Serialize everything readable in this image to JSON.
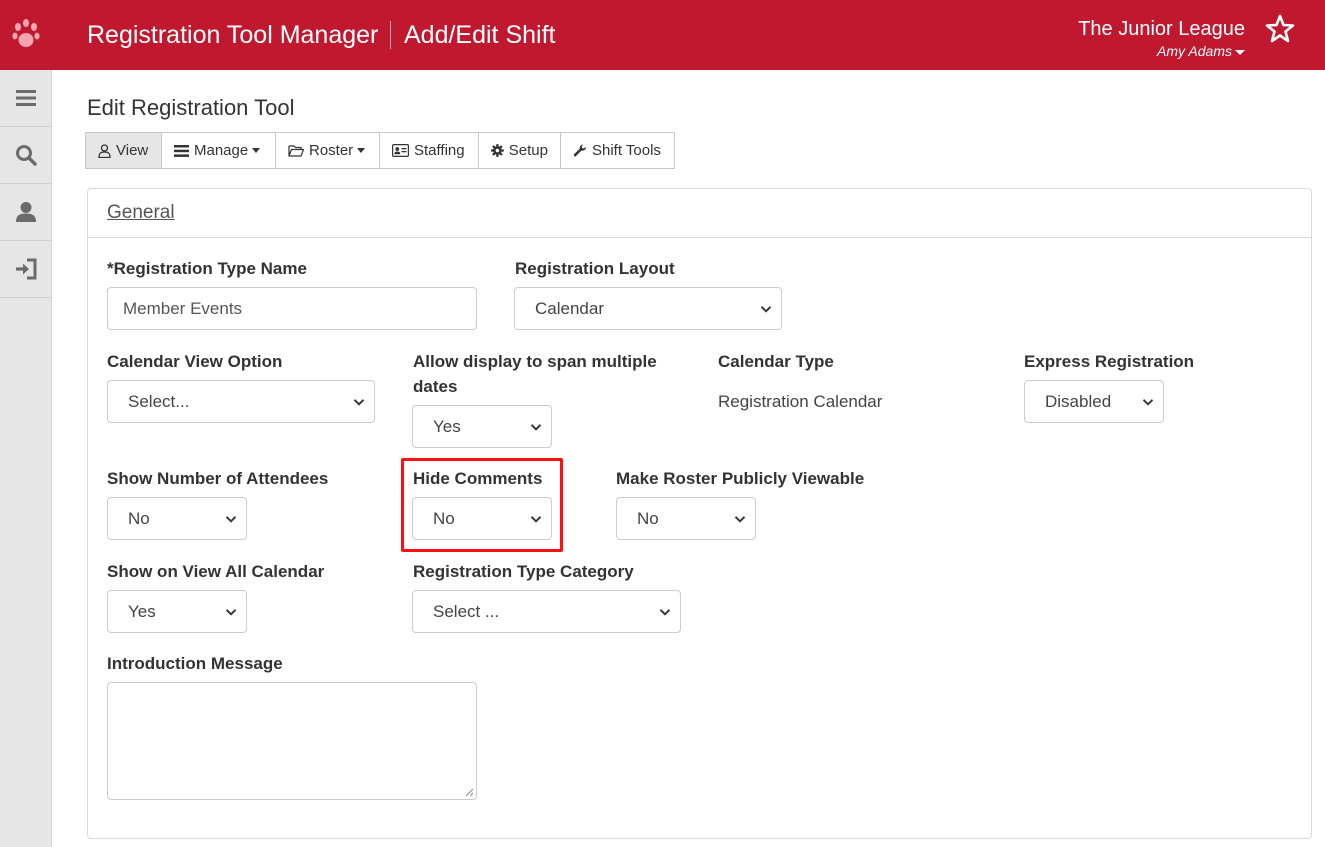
{
  "header": {
    "app_title": "Registration Tool Manager",
    "page_subtitle": "Add/Edit Shift",
    "org_name": "The Junior League",
    "user_name": "Amy Adams",
    "brand_color": "#c0182e"
  },
  "sidebar": {
    "items": [
      {
        "name": "menu",
        "icon": "hamburger-icon"
      },
      {
        "name": "search",
        "icon": "search-icon"
      },
      {
        "name": "profile",
        "icon": "user-icon"
      },
      {
        "name": "logout",
        "icon": "sign-out-icon"
      }
    ]
  },
  "page": {
    "title": "Edit Registration Tool"
  },
  "toolbar": {
    "view_label": "View",
    "manage_label": "Manage",
    "roster_label": "Roster",
    "staffing_label": "Staffing",
    "setup_label": "Setup",
    "shift_tools_label": "Shift Tools"
  },
  "section": {
    "title": "General"
  },
  "form": {
    "registration_type_name": {
      "label": "*Registration Type Name",
      "value": "Member Events"
    },
    "registration_layout": {
      "label": "Registration Layout",
      "value": "Calendar"
    },
    "calendar_view_option": {
      "label": "Calendar View Option",
      "value": "Select..."
    },
    "allow_span": {
      "label_line1": "Allow display to span multiple",
      "label_line2": "dates",
      "value": "Yes"
    },
    "calendar_type": {
      "label": "Calendar Type",
      "value": "Registration Calendar"
    },
    "express_registration": {
      "label": "Express Registration",
      "value": "Disabled"
    },
    "show_number_attendees": {
      "label": "Show Number of Attendees",
      "value": "No"
    },
    "hide_comments": {
      "label": "Hide Comments",
      "value": "No"
    },
    "roster_public": {
      "label": "Make Roster Publicly Viewable",
      "value": "No"
    },
    "show_view_all_calendar": {
      "label": "Show on View All Calendar",
      "value": "Yes"
    },
    "registration_type_category": {
      "label": "Registration Type Category",
      "value": "Select ..."
    },
    "introduction_message": {
      "label": "Introduction Message",
      "value": ""
    }
  }
}
